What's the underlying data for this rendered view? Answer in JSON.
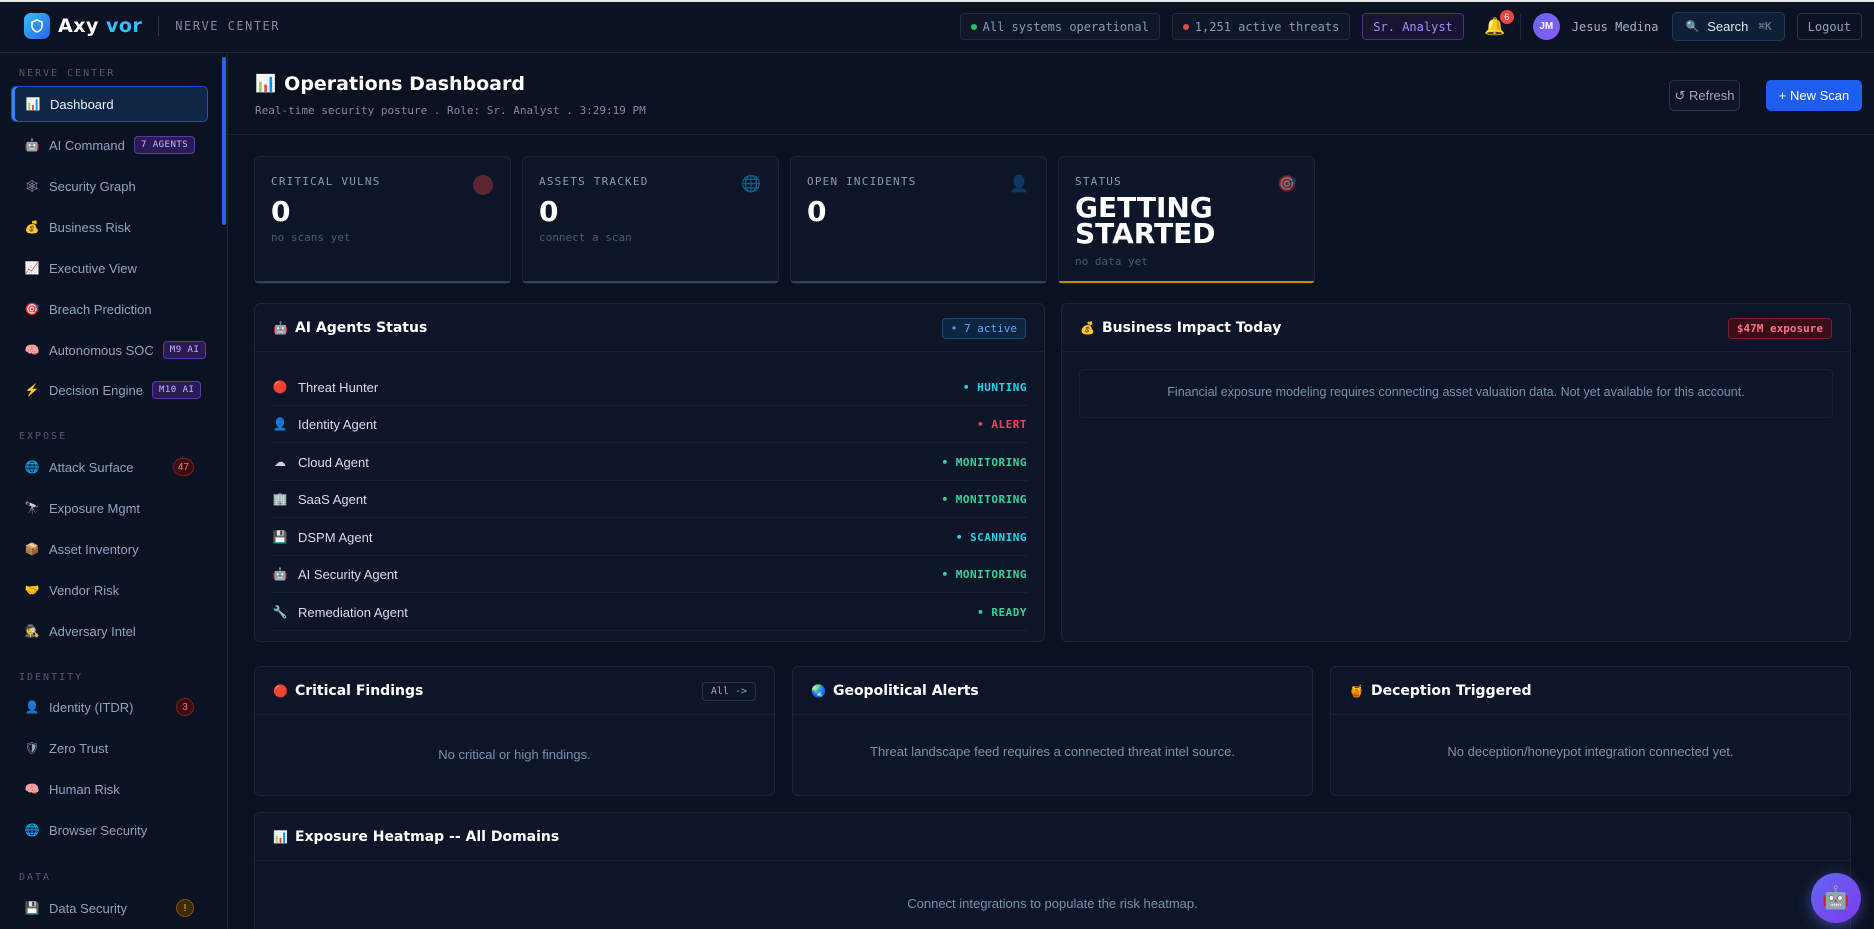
{
  "topbar": {
    "brand_prefix": "Axy",
    "brand_accent": "vor",
    "brand_sub": "NERVE CENTER",
    "systems_status": "All systems operational",
    "threats": "1,251 active threats",
    "role": "Sr. Analyst",
    "notifications": "6",
    "avatar_initials": "JM",
    "username": "Jesus Medina",
    "search_label": "Search",
    "search_kbd": "⌘K",
    "logout": "Logout"
  },
  "sidebar": {
    "sections": [
      {
        "title": "NERVE CENTER"
      },
      {
        "title": "EXPOSE"
      },
      {
        "title": "IDENTITY"
      },
      {
        "title": "DATA"
      }
    ],
    "items": [
      {
        "label": "Dashboard",
        "icon": "bar-chart-icon",
        "glyph": "📊",
        "active": true
      },
      {
        "label": "AI Command",
        "icon": "robot-icon",
        "glyph": "🤖",
        "tag": "7 AGENTS"
      },
      {
        "label": "Security Graph",
        "icon": "graph-icon",
        "glyph": "🕸"
      },
      {
        "label": "Business Risk",
        "icon": "money-bag-icon",
        "glyph": "💰"
      },
      {
        "label": "Executive View",
        "icon": "trend-chart-icon",
        "glyph": "📈"
      },
      {
        "label": "Breach Prediction",
        "icon": "target-icon",
        "glyph": "🎯"
      },
      {
        "label": "Autonomous SOC",
        "icon": "brain-icon",
        "glyph": "🧠",
        "tag": "M9 AI"
      },
      {
        "label": "Decision Engine",
        "icon": "lightning-icon",
        "glyph": "⚡",
        "tag": "M10 AI"
      },
      {
        "label": "Attack Surface",
        "icon": "globe-icon",
        "glyph": "🌐",
        "count": "47"
      },
      {
        "label": "Exposure Mgmt",
        "icon": "telescope-icon",
        "glyph": "🔭"
      },
      {
        "label": "Asset Inventory",
        "icon": "package-icon",
        "glyph": "📦"
      },
      {
        "label": "Vendor Risk",
        "icon": "handshake-icon",
        "glyph": "🤝"
      },
      {
        "label": "Adversary Intel",
        "icon": "spy-icon",
        "glyph": "🕵"
      },
      {
        "label": "Identity (ITDR)",
        "icon": "user-icon",
        "glyph": "👤",
        "count": "3"
      },
      {
        "label": "Zero Trust",
        "icon": "shield-icon",
        "glyph": "🛡"
      },
      {
        "label": "Human Risk",
        "icon": "brain-icon",
        "glyph": "🧠"
      },
      {
        "label": "Browser Security",
        "icon": "globe-icon",
        "glyph": "🌐"
      },
      {
        "label": "Data Security",
        "icon": "floppy-disk-icon",
        "glyph": "💾",
        "count": "!"
      }
    ]
  },
  "header": {
    "title": "Operations Dashboard",
    "title_icon": "📊",
    "subtitle": "Real-time security posture . Role: Sr. Analyst . 3:29:19 PM",
    "refresh_label": "↺ Refresh",
    "new_scan_label": "+ New Scan"
  },
  "stats": [
    {
      "label": "CRITICAL VULNS",
      "value": "0",
      "note": "no scans yet",
      "icon": "red-dot-icon",
      "color": "#ef4444"
    },
    {
      "label": "ASSETS TRACKED",
      "value": "0",
      "note": "connect a scan",
      "icon": "globe-icon",
      "color": "#60a5fa"
    },
    {
      "label": "OPEN INCIDENTS",
      "value": "0",
      "note": "",
      "icon": "user-icon",
      "color": "#64748b"
    },
    {
      "label": "STATUS",
      "value_line1": "GETTING",
      "value_line2": "STARTED",
      "note": "no data yet",
      "icon": "target-icon",
      "color": "#f87171"
    }
  ],
  "agents_panel": {
    "title": "AI Agents Status",
    "badge": "• 7 active",
    "agents": [
      {
        "name": "Threat Hunter",
        "icon": "red-circle-icon",
        "glyph": "🔴",
        "status": "• HUNTING",
        "color": "#22d3ee"
      },
      {
        "name": "Identity Agent",
        "icon": "user-icon",
        "glyph": "👤",
        "status": "• ALERT",
        "color": "#f43f5e"
      },
      {
        "name": "Cloud Agent",
        "icon": "cloud-icon",
        "glyph": "☁",
        "status": "• MONITORING",
        "color": "#34d399"
      },
      {
        "name": "SaaS Agent",
        "icon": "building-icon",
        "glyph": "🏢",
        "status": "• MONITORING",
        "color": "#34d399"
      },
      {
        "name": "DSPM Agent",
        "icon": "floppy-disk-icon",
        "glyph": "💾",
        "status": "• SCANNING",
        "color": "#22d3ee"
      },
      {
        "name": "AI Security Agent",
        "icon": "robot-icon",
        "glyph": "🤖",
        "status": "• MONITORING",
        "color": "#34d399"
      },
      {
        "name": "Remediation Agent",
        "icon": "wrench-icon",
        "glyph": "🔧",
        "status": "• READY",
        "color": "#34d399"
      }
    ]
  },
  "business_panel": {
    "title": "Business Impact Today",
    "badge": "$47M exposure",
    "message": "Financial exposure modeling requires connecting asset valuation data. Not yet available for this account."
  },
  "findings_panel": {
    "title": "Critical Findings",
    "link": "All ->",
    "message": "No critical or high findings."
  },
  "geo_panel": {
    "title": "Geopolitical Alerts",
    "message": "Threat landscape feed requires a connected threat intel source."
  },
  "deception_panel": {
    "title": "Deception Triggered",
    "message": "No deception/honeypot integration connected yet."
  },
  "heatmap_panel": {
    "title": "Exposure Heatmap -- All Domains",
    "message": "Connect integrations to populate the risk heatmap."
  }
}
